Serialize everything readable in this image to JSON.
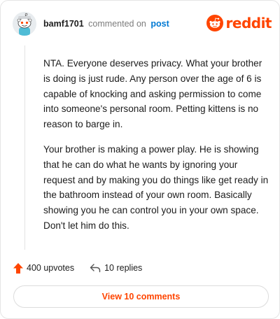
{
  "comment": {
    "username": "bamf1701",
    "commented_on_text": "commented on",
    "post_link_text": "post",
    "paragraphs": [
      "NTA. Everyone deserves privacy. What your brother is doing is just rude. Any person over the age of 6 is capable of knocking and asking permission to come into someone's personal room. Petting kittens is no reason to barge in.",
      "Your brother is making a power play. He is showing that he can do what he wants by ignoring your request and by making you do things like get ready in the bathroom instead of your own room. Basically showing you he can control you in your own space. Don't let him do this."
    ]
  },
  "brand": {
    "wordmark": "reddit",
    "logo_icon": "reddit-snoo-icon",
    "accent_color": "#ff4500"
  },
  "actions": {
    "upvotes_label": "400 upvotes",
    "upvote_icon": "upvote-arrow-icon",
    "replies_label": "10 replies",
    "reply_icon": "reply-arrow-icon"
  },
  "view_comments_label": "View 10 comments",
  "colors": {
    "link": "#0079d3",
    "muted": "#7c7c7c",
    "text": "#1c1c1c"
  }
}
